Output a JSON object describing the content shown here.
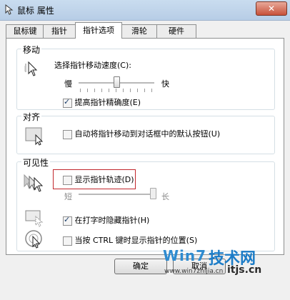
{
  "window": {
    "title": "鼠标 属性",
    "close_label": "✕"
  },
  "tabs": [
    {
      "label": "鼠标键"
    },
    {
      "label": "指针"
    },
    {
      "label": "指针选项",
      "active": true
    },
    {
      "label": "滑轮"
    },
    {
      "label": "硬件"
    }
  ],
  "motion": {
    "heading": "移动",
    "speed_label": "选择指针移动速度(C):",
    "slow": "慢",
    "fast": "快",
    "speed_level": 0.5,
    "precision_label": "提高指针精确度(E)",
    "precision_checked": true
  },
  "snap": {
    "heading": "对齐",
    "label": "自动将指针移动到对话框中的默认按钮(U)",
    "checked": false
  },
  "visibility": {
    "heading": "可见性",
    "trails_label": "显示指针轨迹(D)",
    "trails_checked": false,
    "short": "短",
    "long": "长",
    "trail_level": 1.0,
    "hide_label": "在打字时隐藏指针(H)",
    "hide_checked": true,
    "ctrl_label": "当按 CTRL 键时显示指针的位置(S)",
    "ctrl_checked": false
  },
  "buttons": {
    "ok": "确定",
    "cancel": "取消"
  },
  "watermark": {
    "logo": "Win7",
    "cn": "技术网",
    "url": "www.win7zhijia.cn",
    "url2": "itjs.cn"
  },
  "colors": {
    "highlight": "#c1272d",
    "titlebar": "#c9dcef"
  },
  "icons": [
    "mouse-icon",
    "pointer-speed-icon",
    "snap-icon",
    "trails-icon",
    "hide-pointer-icon",
    "locate-pointer-icon"
  ]
}
